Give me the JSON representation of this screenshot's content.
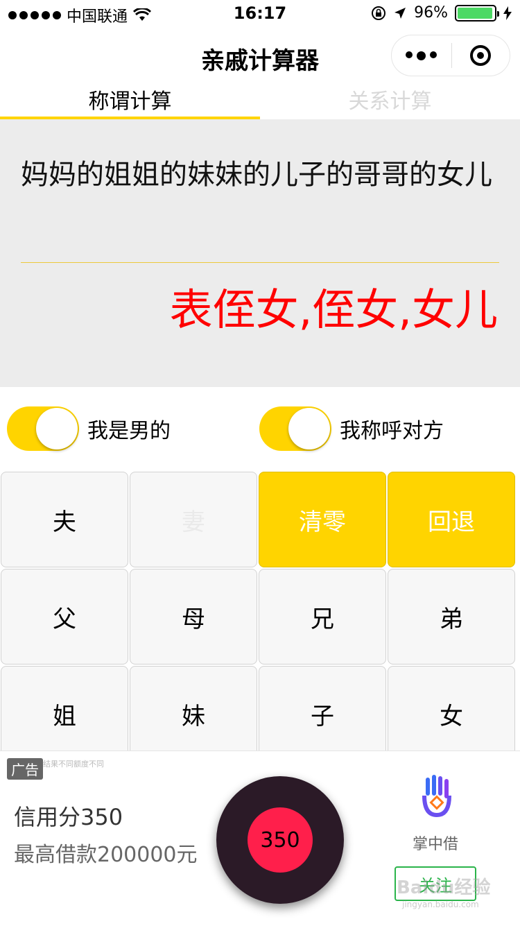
{
  "status_bar": {
    "carrier": "中国联通",
    "time": "16:17",
    "battery_percent": "96%",
    "battery_level": 0.96
  },
  "nav": {
    "title": "亲戚计算器"
  },
  "tabs": [
    {
      "label": "称谓计算",
      "active": true
    },
    {
      "label": "关系计算",
      "active": false
    }
  ],
  "display": {
    "expression": "妈妈的姐姐的妹妹的儿子的哥哥的女儿",
    "result": "表侄女,侄女,女儿"
  },
  "toggles": [
    {
      "label": "我是男的",
      "on": true
    },
    {
      "label": "我称呼对方",
      "on": true
    }
  ],
  "keypad": {
    "keys": [
      "夫",
      "妻",
      "清零",
      "回退",
      "父",
      "母",
      "兄",
      "弟",
      "姐",
      "妹",
      "子",
      "女"
    ]
  },
  "ad": {
    "badge": "广告",
    "note": "结果不同额度不同",
    "line1": "信用分350",
    "line2": "最高借款200000元",
    "disc_value": "350",
    "app_name": "掌中借",
    "follow_label": "关注",
    "watermark": "Baidu经验",
    "watermark_sub": "jingyan.baidu.com"
  },
  "colors": {
    "accent": "#ffd400",
    "result": "#ff0000",
    "display_bg": "#ececec",
    "follow": "#2ab44a"
  }
}
